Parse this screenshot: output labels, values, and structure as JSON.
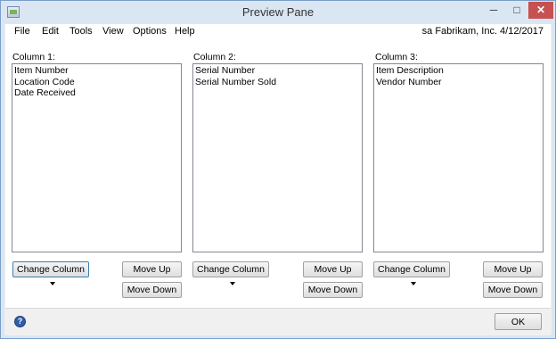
{
  "window": {
    "title": "Preview Pane",
    "controls": {
      "minimize": "─",
      "maximize": "□",
      "close": "✕"
    }
  },
  "menu": {
    "items": [
      "File",
      "Edit",
      "Tools",
      "View",
      "Options",
      "Help"
    ],
    "status": "sa  Fabrikam, Inc.  4/12/2017"
  },
  "columns": [
    {
      "label": "Column 1:",
      "items": [
        "Item Number",
        "Location Code",
        "Date Received"
      ],
      "change_label": "Change Column",
      "move_up_label": "Move Up",
      "move_down_label": "Move Down"
    },
    {
      "label": "Column 2:",
      "items": [
        "Serial Number",
        "Serial Number Sold"
      ],
      "change_label": "Change Column",
      "move_up_label": "Move Up",
      "move_down_label": "Move Down"
    },
    {
      "label": "Column 3:",
      "items": [
        "Item Description",
        "Vendor Number"
      ],
      "change_label": "Change Column",
      "move_up_label": "Move Up",
      "move_down_label": "Move Down"
    }
  ],
  "footer": {
    "help_icon": "help-icon",
    "ok_label": "OK"
  }
}
